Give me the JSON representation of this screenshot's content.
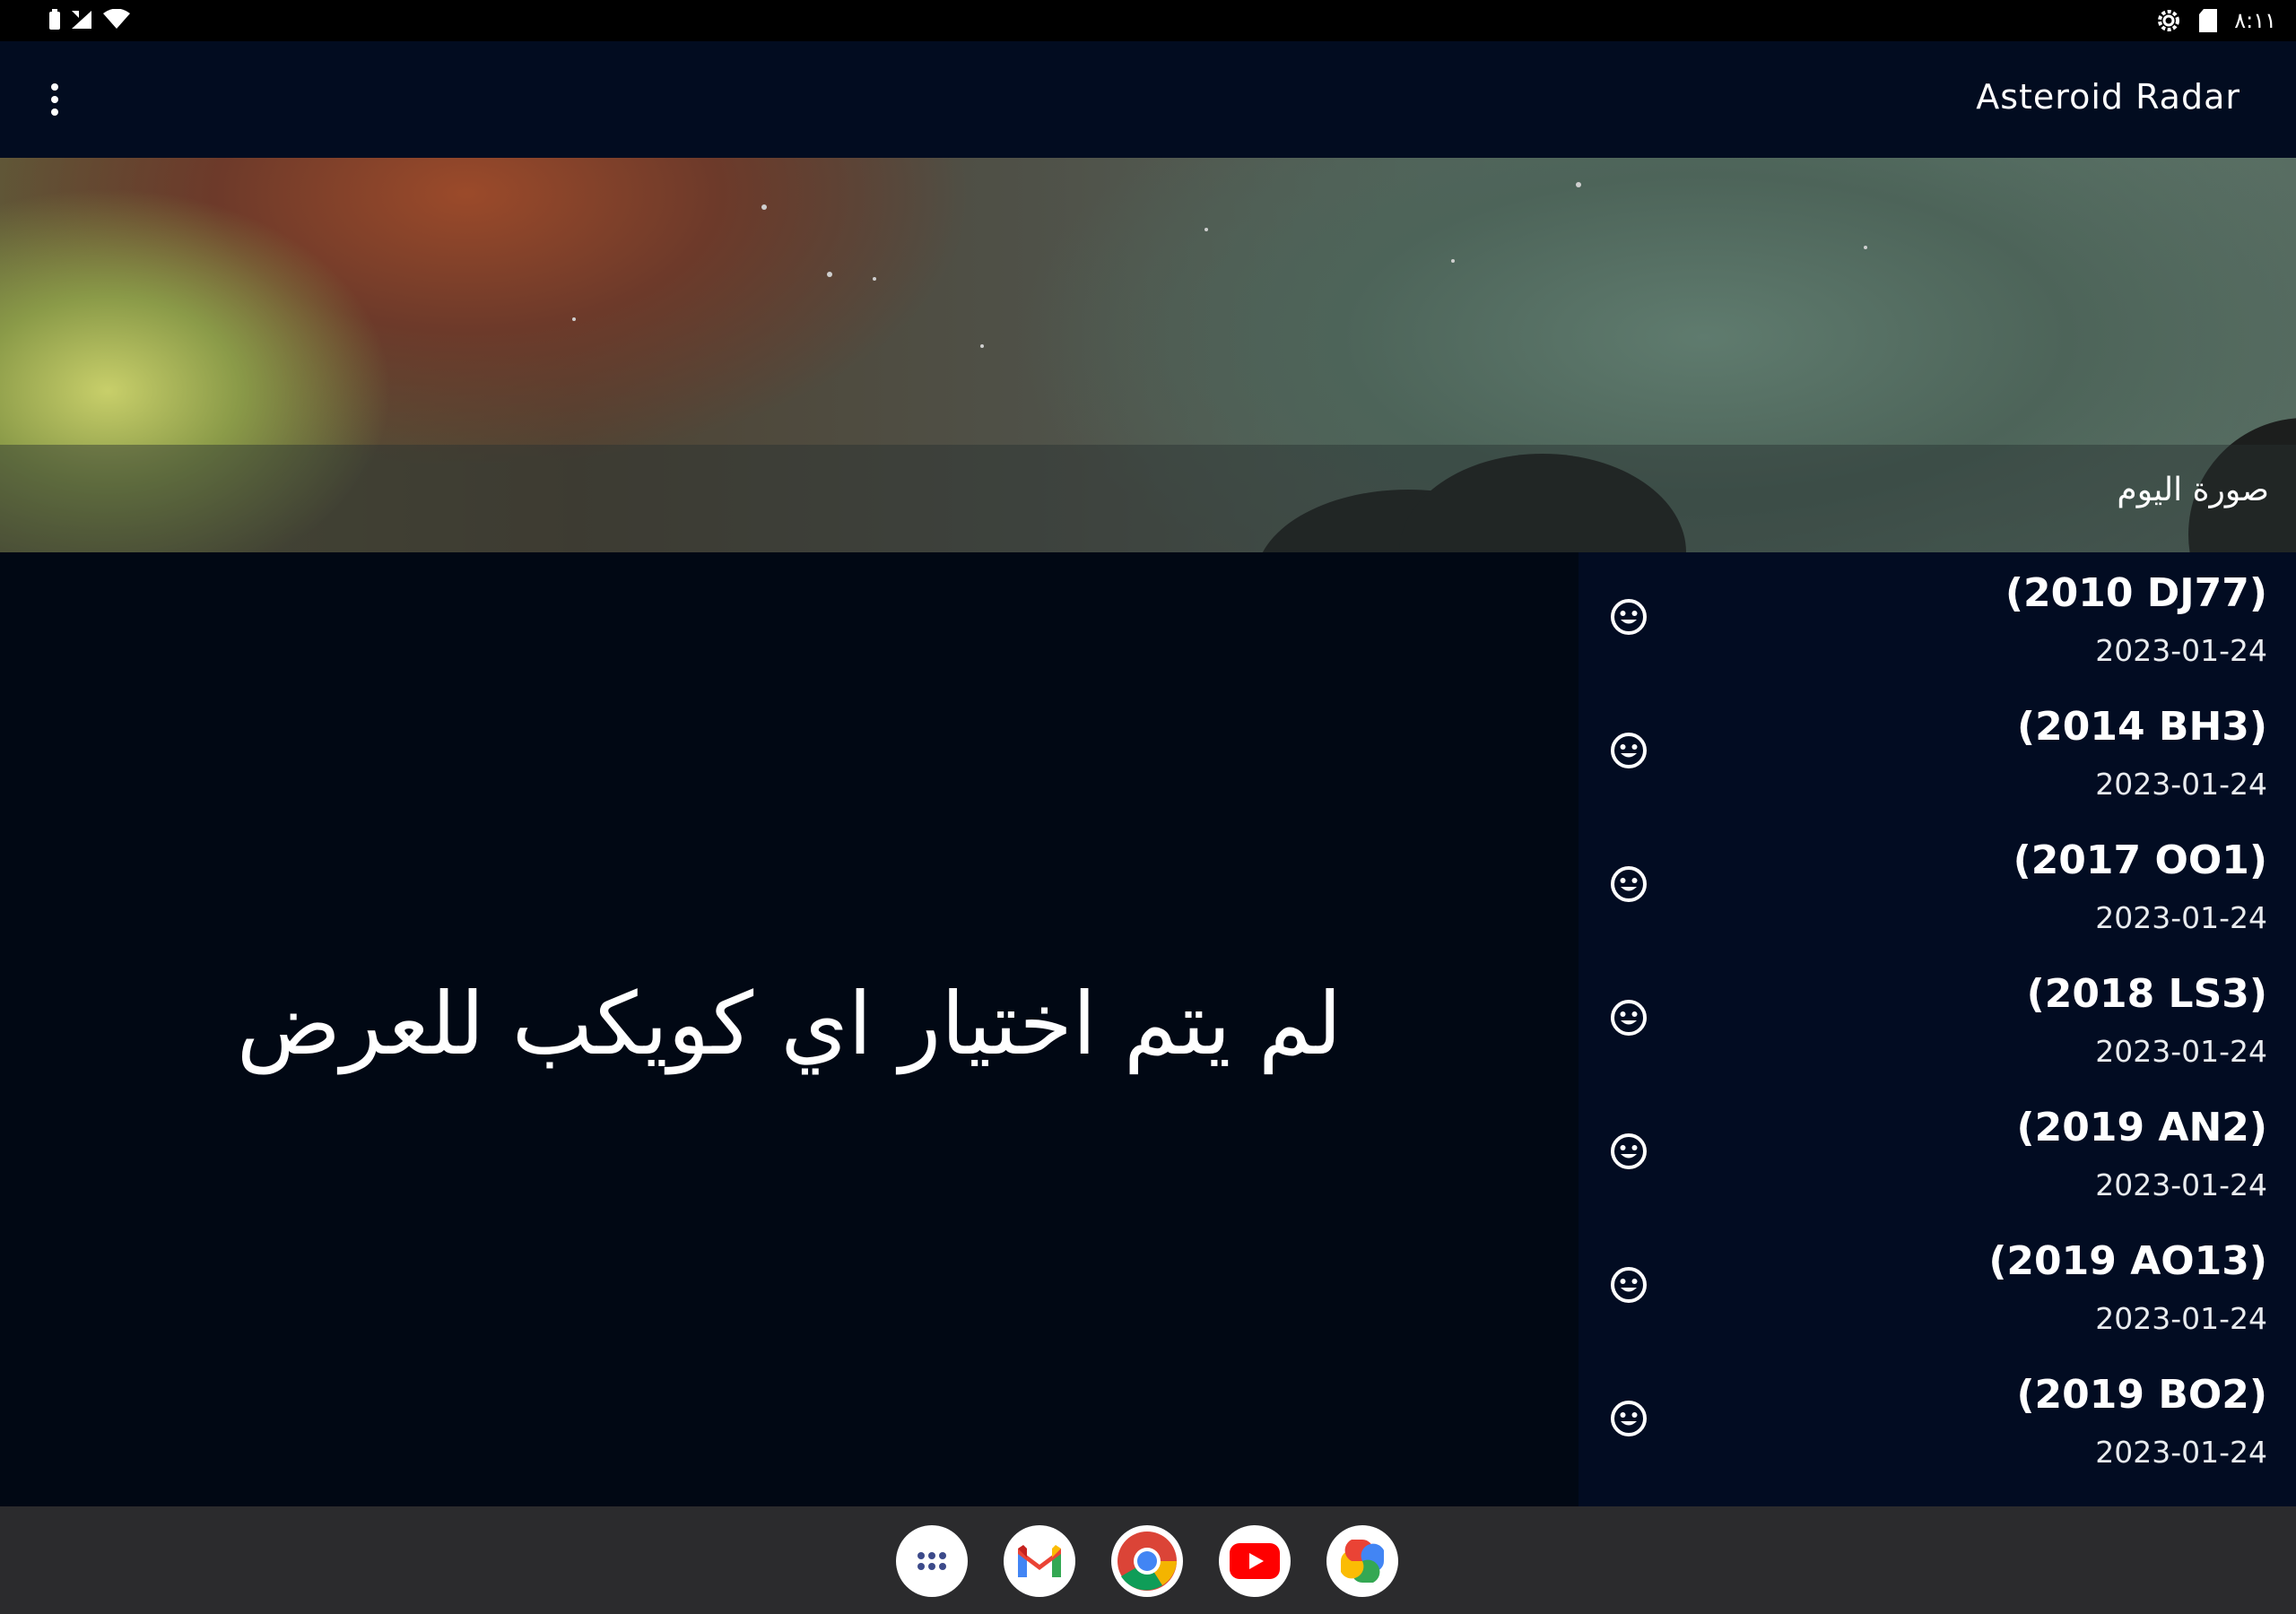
{
  "status_bar": {
    "time": "٨:١١",
    "left_icons": [
      "battery-icon",
      "signal-icon",
      "wifi-icon"
    ],
    "right_icons": [
      "settings-icon",
      "sd-card-icon"
    ]
  },
  "app_bar": {
    "title": "Asteroid Radar",
    "menu_icon": "more-vert-icon"
  },
  "picture_of_day": {
    "caption": "صورة اليوم"
  },
  "detail": {
    "empty_message": "لم يتم اختيار اي كويكب للعرض"
  },
  "asteroids": [
    {
      "name": "(2010 DJ77)",
      "date": "2023-01-24",
      "status_icon": "smiley-icon"
    },
    {
      "name": "(2014 BH3)",
      "date": "2023-01-24",
      "status_icon": "smiley-icon"
    },
    {
      "name": "(2017 OO1)",
      "date": "2023-01-24",
      "status_icon": "smiley-icon"
    },
    {
      "name": "(2018 LS3)",
      "date": "2023-01-24",
      "status_icon": "smiley-icon"
    },
    {
      "name": "(2019 AN2)",
      "date": "2023-01-24",
      "status_icon": "smiley-icon"
    },
    {
      "name": "(2019 AO13)",
      "date": "2023-01-24",
      "status_icon": "smiley-icon"
    },
    {
      "name": "(2019 BO2)",
      "date": "2023-01-24",
      "status_icon": "smiley-icon"
    }
  ],
  "dock": [
    {
      "name": "app-drawer-icon"
    },
    {
      "name": "gmail-icon"
    },
    {
      "name": "chrome-icon"
    },
    {
      "name": "youtube-icon"
    },
    {
      "name": "photos-icon"
    }
  ],
  "colors": {
    "background": "#010814",
    "app_bar": "#020c20",
    "list_background": "#020c22",
    "nav_bar": "#2b2b2d"
  }
}
